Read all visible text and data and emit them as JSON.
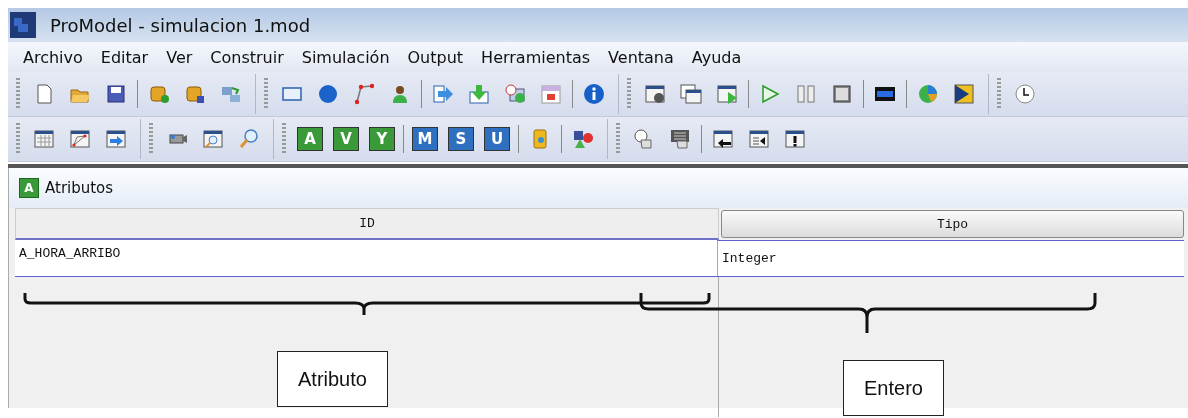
{
  "window": {
    "title": "ProModel - simulacion 1.mod"
  },
  "menu": [
    {
      "label": "Archivo"
    },
    {
      "label": "Editar"
    },
    {
      "label": "Ver"
    },
    {
      "label": "Construir"
    },
    {
      "label": "Simulación"
    },
    {
      "label": "Output"
    },
    {
      "label": "Herramientas"
    },
    {
      "label": "Ventana"
    },
    {
      "label": "Ayuda"
    }
  ],
  "letter_buttons": [
    {
      "text": "A",
      "color": "#3a9a3a"
    },
    {
      "text": "V",
      "color": "#3a9a3a"
    },
    {
      "text": "Y",
      "color": "#3a9a3a"
    },
    {
      "text": "M",
      "color": "#2f6fc0"
    },
    {
      "text": "S",
      "color": "#2f6fc0"
    },
    {
      "text": "U",
      "color": "#2f6fc0"
    }
  ],
  "child_window": {
    "icon_letter": "A",
    "title": "Atributos"
  },
  "table": {
    "columns": [
      "ID",
      "Tipo"
    ],
    "rows": [
      [
        "A_HORA_ARRIBO",
        "Integer"
      ]
    ]
  },
  "annotations": [
    {
      "text": "Atributo"
    },
    {
      "text": "Entero"
    }
  ]
}
